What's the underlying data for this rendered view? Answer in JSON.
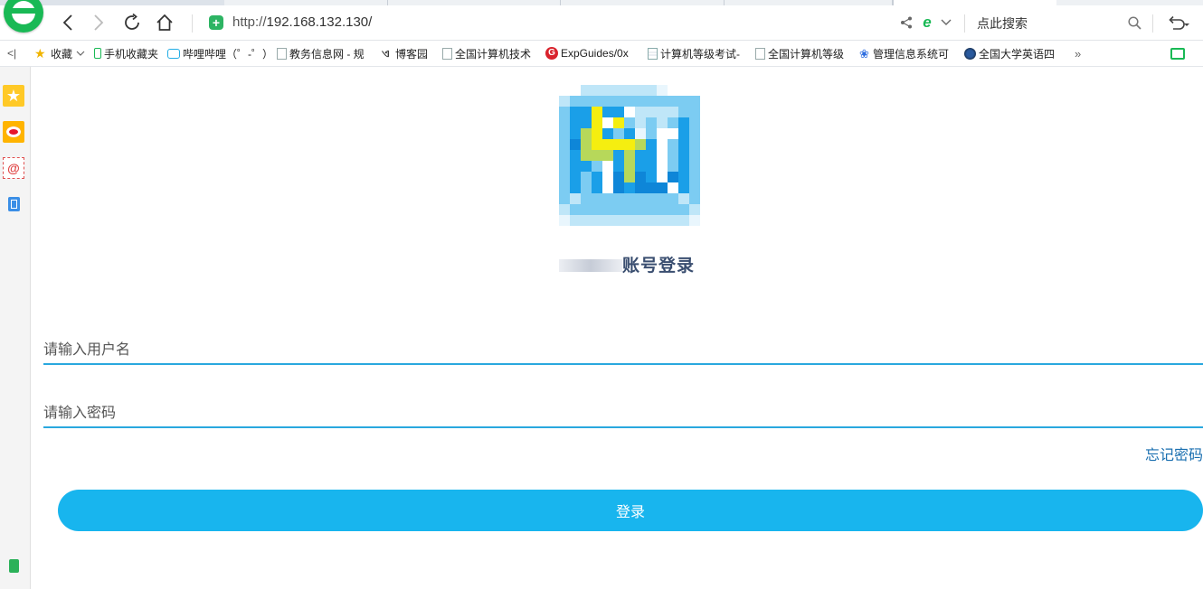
{
  "browser": {
    "url_protocol": "http://",
    "url_host": "192.168.132.130/",
    "search_placeholder": "点此搜索"
  },
  "bookmarks": [
    {
      "label": "收藏",
      "icon": "star-icon"
    },
    {
      "label": "手机收藏夹",
      "icon": "phone-icon"
    },
    {
      "label": "哔哩哔哩（゜-゜）",
      "icon": "bilibili-icon"
    },
    {
      "label": "教务信息网 - 规",
      "icon": "page-icon"
    },
    {
      "label": "博客园",
      "icon": "cnblogs-icon"
    },
    {
      "label": "全国计算机技术",
      "icon": "page-icon"
    },
    {
      "label": "ExpGuides/0x",
      "icon": "expguides-icon"
    },
    {
      "label": "计算机等级考试-",
      "icon": "doc-icon"
    },
    {
      "label": "全国计算机等级",
      "icon": "page-icon"
    },
    {
      "label": "管理信息系统可",
      "icon": "baidu-paw-icon"
    },
    {
      "label": "全国大学英语四",
      "icon": "globe-icon"
    }
  ],
  "login": {
    "title": "账号登录",
    "username_placeholder": "请输入用户名",
    "password_placeholder": "请输入密码",
    "forgot_label": "忘记密码",
    "submit_label": "登录"
  },
  "colors": {
    "accent": "#18b5ee",
    "underline": "#29a8de",
    "link": "#1a6fb0",
    "browser_green": "#19b955"
  }
}
